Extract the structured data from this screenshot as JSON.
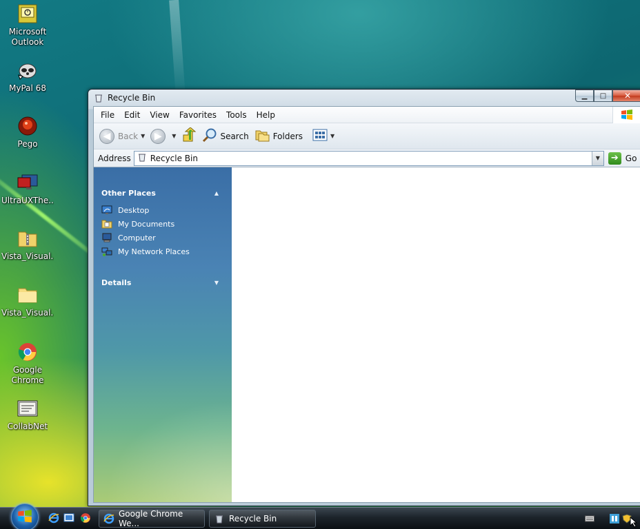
{
  "desktop": {
    "icons": [
      {
        "label": "Microsoft\nOutlook",
        "line1": "Microsoft",
        "line2": "Outlook"
      },
      {
        "line1": "MyPal 68",
        "line2": ""
      },
      {
        "line1": "Pego",
        "line2": ""
      },
      {
        "line1": "UltraUXThe...",
        "line2": ""
      },
      {
        "line1": "Vista_Visual...",
        "line2": ""
      },
      {
        "line1": "Vista_Visual...",
        "line2": ""
      },
      {
        "line1": "Google",
        "line2": "Chrome"
      },
      {
        "line1": "CollabNet",
        "line2": ""
      }
    ]
  },
  "window": {
    "title": "Recycle Bin",
    "menu": [
      "File",
      "Edit",
      "View",
      "Favorites",
      "Tools",
      "Help"
    ],
    "toolbar": {
      "back_label": "Back",
      "search_label": "Search",
      "folders_label": "Folders"
    },
    "address": {
      "label": "Address",
      "value": "Recycle Bin",
      "go_label": "Go"
    },
    "taskpane": {
      "other_places_title": "Other Places",
      "links": [
        "Desktop",
        "My Documents",
        "Computer",
        "My Network Places"
      ],
      "details_title": "Details"
    }
  },
  "taskbar": {
    "tasks": [
      "Google Chrome We...",
      "Recycle Bin"
    ]
  },
  "colors": {
    "taskpane_top": "#3a6ea6",
    "taskpane_bottom": "#aacb76",
    "go_green": "#2f8a1c",
    "close_red": "#c23a1e"
  }
}
